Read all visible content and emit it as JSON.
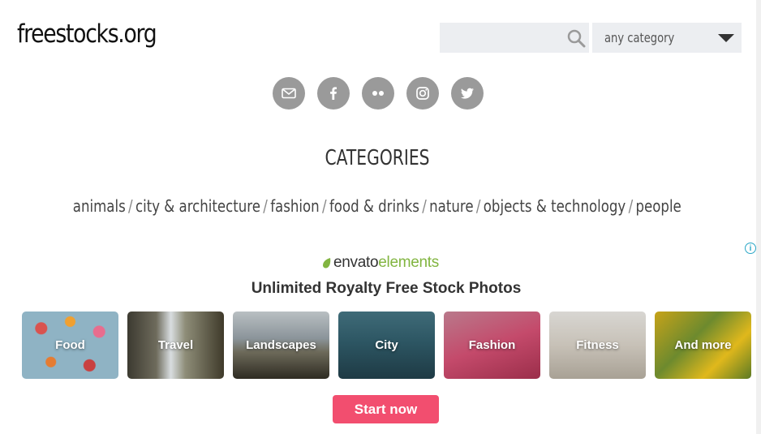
{
  "site": {
    "logo": "freestocks.org"
  },
  "search": {
    "placeholder": "",
    "value": ""
  },
  "category_select": {
    "selected": "any category"
  },
  "social": [
    {
      "name": "email",
      "icon": "mail-icon"
    },
    {
      "name": "facebook",
      "icon": "facebook-icon"
    },
    {
      "name": "flickr",
      "icon": "flickr-icon"
    },
    {
      "name": "instagram",
      "icon": "instagram-icon"
    },
    {
      "name": "twitter",
      "icon": "twitter-icon"
    }
  ],
  "categories": {
    "title": "CATEGORIES",
    "links": [
      "animals",
      "city & architecture",
      "fashion",
      "food & drinks",
      "nature",
      "objects & technology",
      "people"
    ],
    "separator": "/"
  },
  "ad": {
    "info": "i",
    "brand_part1": "envato",
    "brand_part2": "elements",
    "headline": "Unlimited Royalty Free Stock Photos",
    "tiles": [
      "Food",
      "Travel",
      "Landscapes",
      "City",
      "Fashion",
      "Fitness",
      "And more"
    ],
    "cta": "Start now",
    "colors": {
      "cta": "#f24e6f",
      "brand_green": "#82b541"
    }
  }
}
